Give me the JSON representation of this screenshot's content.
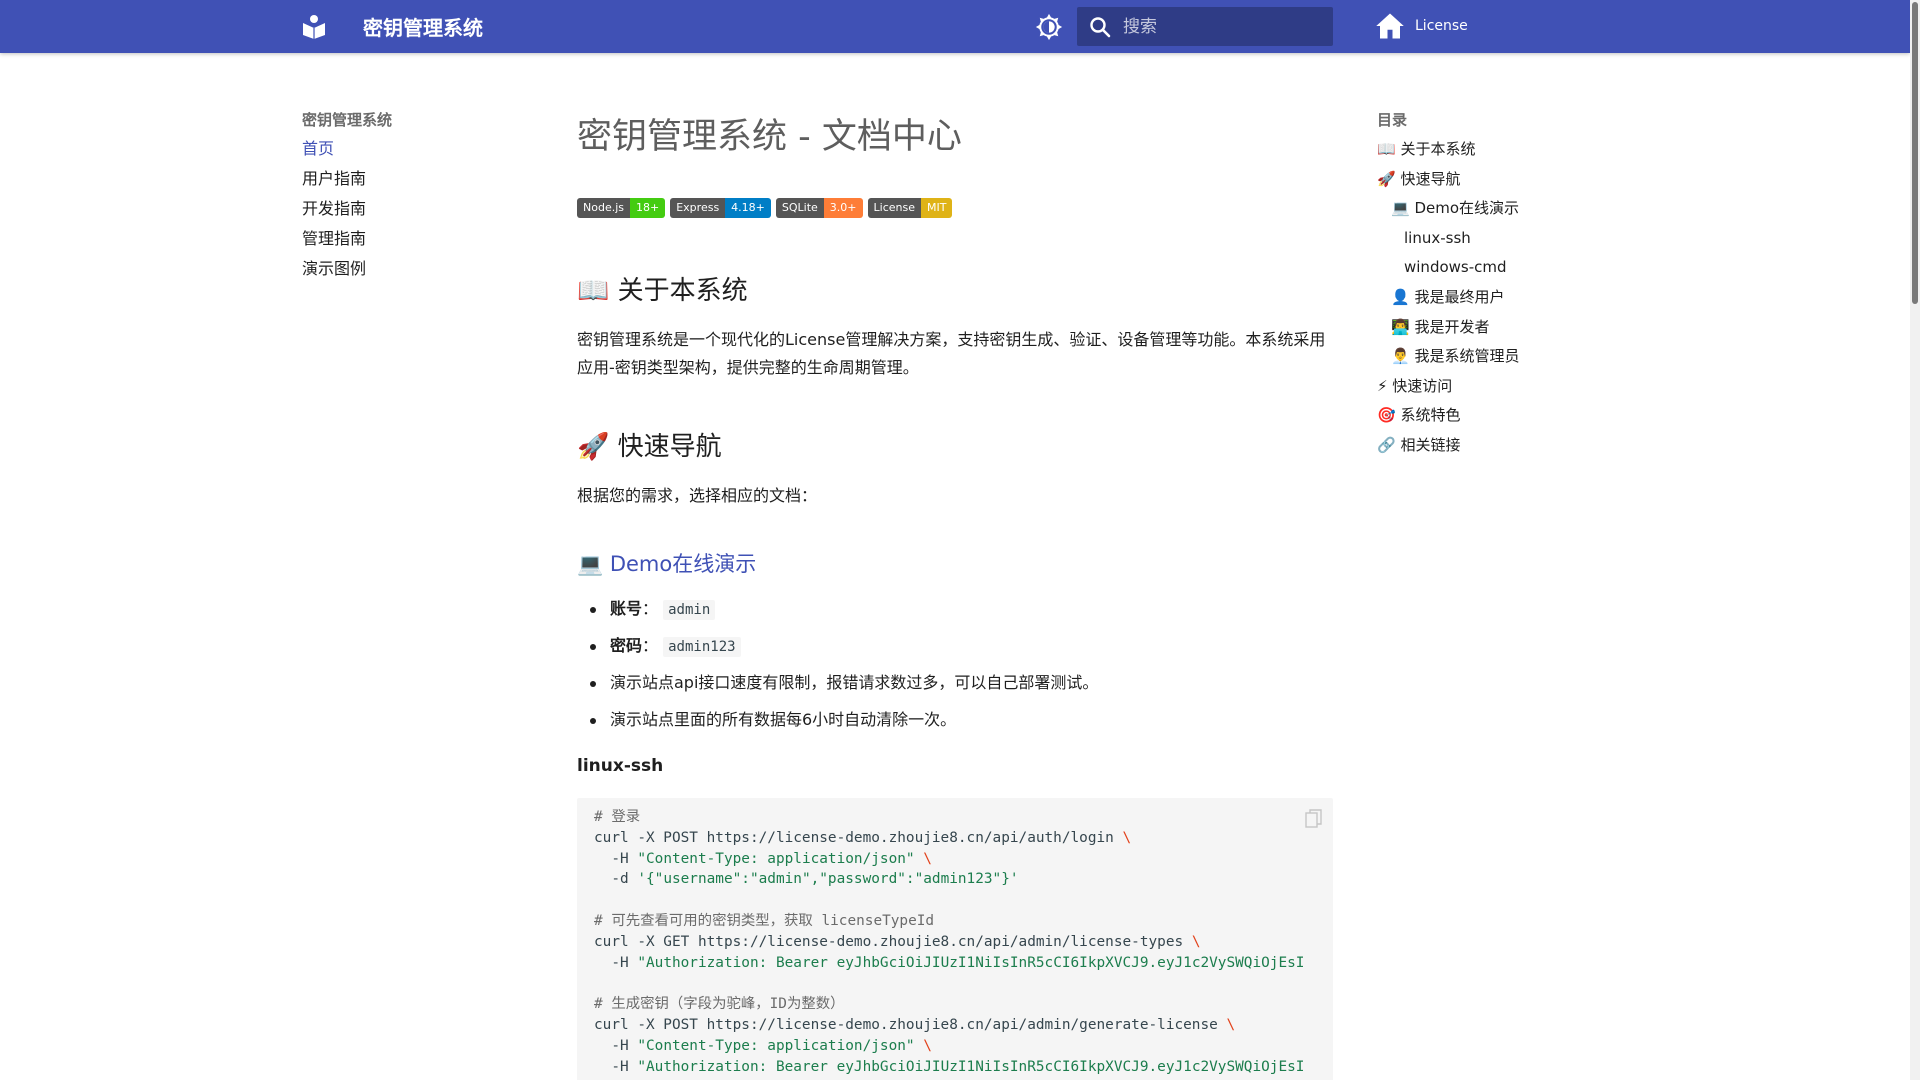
{
  "header": {
    "site_title": "密钥管理系统",
    "search_placeholder": "搜索",
    "repo_label": "License"
  },
  "left_nav": {
    "title": "密钥管理系统",
    "items": [
      {
        "label": "首页",
        "active": true
      },
      {
        "label": "用户指南",
        "active": false
      },
      {
        "label": "开发指南",
        "active": false
      },
      {
        "label": "管理指南",
        "active": false
      },
      {
        "label": "演示图例",
        "active": false
      }
    ]
  },
  "toc": {
    "title": "目录",
    "items": [
      {
        "label": "📖 关于本系统",
        "level": 1
      },
      {
        "label": "🚀 快速导航",
        "level": 1
      },
      {
        "label": "💻 Demo在线演示",
        "level": 2
      },
      {
        "label": "linux-ssh",
        "level": 3
      },
      {
        "label": "windows-cmd",
        "level": 3
      },
      {
        "label": "👤 我是最终用户",
        "level": 2
      },
      {
        "label": "👨‍💻 我是开发者",
        "level": 2
      },
      {
        "label": "👨‍💼 我是系统管理员",
        "level": 2
      },
      {
        "label": "⚡ 快速访问",
        "level": 1
      },
      {
        "label": "🎯 系统特色",
        "level": 1
      },
      {
        "label": "🔗 相关链接",
        "level": 1
      }
    ]
  },
  "main": {
    "page_title": "密钥管理系统 - 文档中心",
    "badges": [
      {
        "label": "Node.js",
        "value": "18+",
        "color": "#4c1"
      },
      {
        "label": "Express",
        "value": "4.18+",
        "color": "#007ec6"
      },
      {
        "label": "SQLite",
        "value": "3.0+",
        "color": "#fe7d37"
      },
      {
        "label": "License",
        "value": "MIT",
        "color": "#dfb317"
      }
    ],
    "about_heading": "📖 关于本系统",
    "about_text": "密钥管理系统是一个现代化的License管理解决方案，支持密钥生成、验证、设备管理等功能。本系统采用应用-密钥类型架构，提供完整的生命周期管理。",
    "nav_heading": "🚀 快速导航",
    "nav_text": "根据您的需求，选择相应的文档：",
    "demo_heading": "💻 Demo在线演示",
    "demo_items": {
      "account_label": "账号",
      "account_value": "admin",
      "password_label": "密码",
      "password_value": "admin123",
      "sep": "：",
      "note1": "演示站点api接口速度有限制，报错请求数过多，可以自己部署测试。",
      "note2": "演示站点里面的所有数据每6小时自动清除一次。"
    },
    "linux_heading": "linux-ssh",
    "code": {
      "c1": "# 登录",
      "l1": "curl -X POST https://license-demo.zhoujie8.cn/api/auth/login ",
      "l2a": "  -H ",
      "l2s": "\"Content-Type: application/json\"",
      "l3a": "  -d ",
      "l3s": "'{\"username\":\"admin\",\"password\":\"admin123\"}'",
      "c2": "# 可先查看可用的密钥类型，获取 licenseTypeId",
      "l4": "curl -X GET https://license-demo.zhoujie8.cn/api/admin/license-types ",
      "l5a": "  -H ",
      "l5s": "\"Authorization: Bearer eyJhbGciOiJIUzI1NiIsInR5cCI6IkpXVCJ9.eyJ1c2VySWQiOjEsI",
      "c3": "# 生成密钥（字段为驼峰，ID为整数）",
      "l6": "curl -X POST https://license-demo.zhoujie8.cn/api/admin/generate-license ",
      "l7a": "  -H ",
      "l7s": "\"Content-Type: application/json\"",
      "l8a": "  -H ",
      "l8s": "\"Authorization: Bearer eyJhbGciOiJIUzI1NiIsInR5cCI6IkpXVCJ9.eyJ1c2VySWQiOjEsI",
      "esc": "\\"
    }
  },
  "colors": {
    "primary": "#4051b5",
    "link": "#3f51b5",
    "string": "#1c7d4d",
    "escape": "#e2421b"
  }
}
